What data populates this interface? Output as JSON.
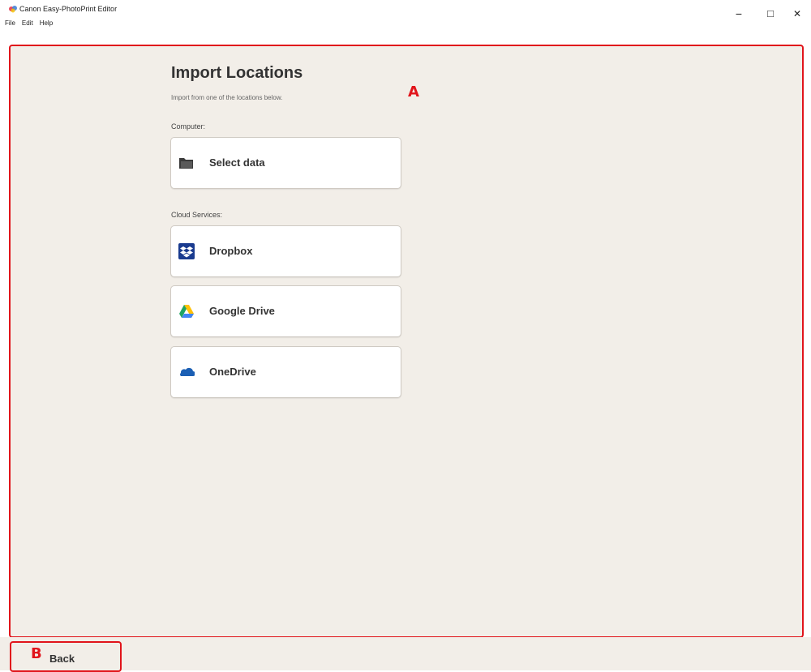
{
  "window": {
    "title": "Canon Easy-PhotoPrint Editor",
    "minimize_glyph": "−",
    "maximize_glyph": "□",
    "close_glyph": "✕"
  },
  "menu": [
    "File",
    "Edit",
    "Help"
  ],
  "main": {
    "title": "Import Locations",
    "subtitle": "Import from one of the locations below.",
    "marker": "A",
    "computer_label": "Computer:",
    "cloud_label": "Cloud Services:",
    "buttons": {
      "select_data": {
        "label": "Select data",
        "icon": "folder-icon"
      },
      "dropbox": {
        "label": "Dropbox",
        "icon": "dropbox-icon"
      },
      "google_drive": {
        "label": "Google Drive",
        "icon": "google-drive-icon"
      },
      "onedrive": {
        "label": "OneDrive",
        "icon": "onedrive-icon"
      }
    }
  },
  "footer": {
    "marker": "B",
    "back_label": "Back"
  },
  "colors": {
    "highlight": "#e1141b",
    "background": "#f2eee8",
    "dropbox_blue": "#1a3b8f",
    "onedrive_blue": "#1b5fb4"
  }
}
